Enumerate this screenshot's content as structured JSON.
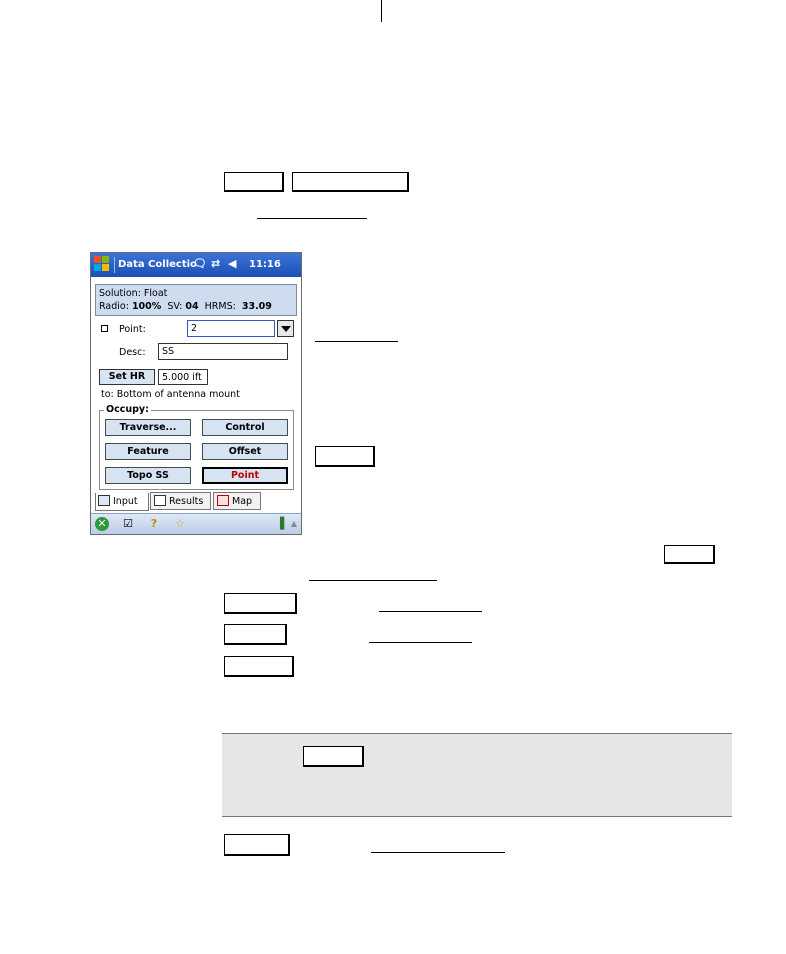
{
  "pda": {
    "title": "Data Collectio",
    "clock": "11:16",
    "icons": [
      "windows-start-icon",
      "speech-bubble-icon",
      "connectivity-icon",
      "volume-icon"
    ],
    "solution_line": "Solution:  Float",
    "radio_label": "Radio:",
    "radio_value": "100%",
    "sv_label": "SV:",
    "sv_value": "04",
    "hrms_label": "HRMS:",
    "hrms_value": "33.09",
    "point_label": "Point:",
    "point_value": "2",
    "desc_label": "Desc:",
    "desc_value": "SS",
    "set_hr_label": "Set HR",
    "hr_value": "5.000 ift",
    "hr_to": "to: Bottom of antenna mount",
    "occupy_title": "Occupy:",
    "buttons": {
      "traverse": "Traverse...",
      "control": "Control",
      "feature": "Feature",
      "offset": "Offset",
      "topo_ss": "Topo SS",
      "point": "Point"
    },
    "tabs": {
      "input": "Input",
      "results": "Results",
      "map": "Map"
    },
    "colors": {
      "title_bar": "#1b4fb6",
      "panel": "#cddcee",
      "button": "#d6e3f3",
      "selected_text": "#c00000"
    }
  }
}
